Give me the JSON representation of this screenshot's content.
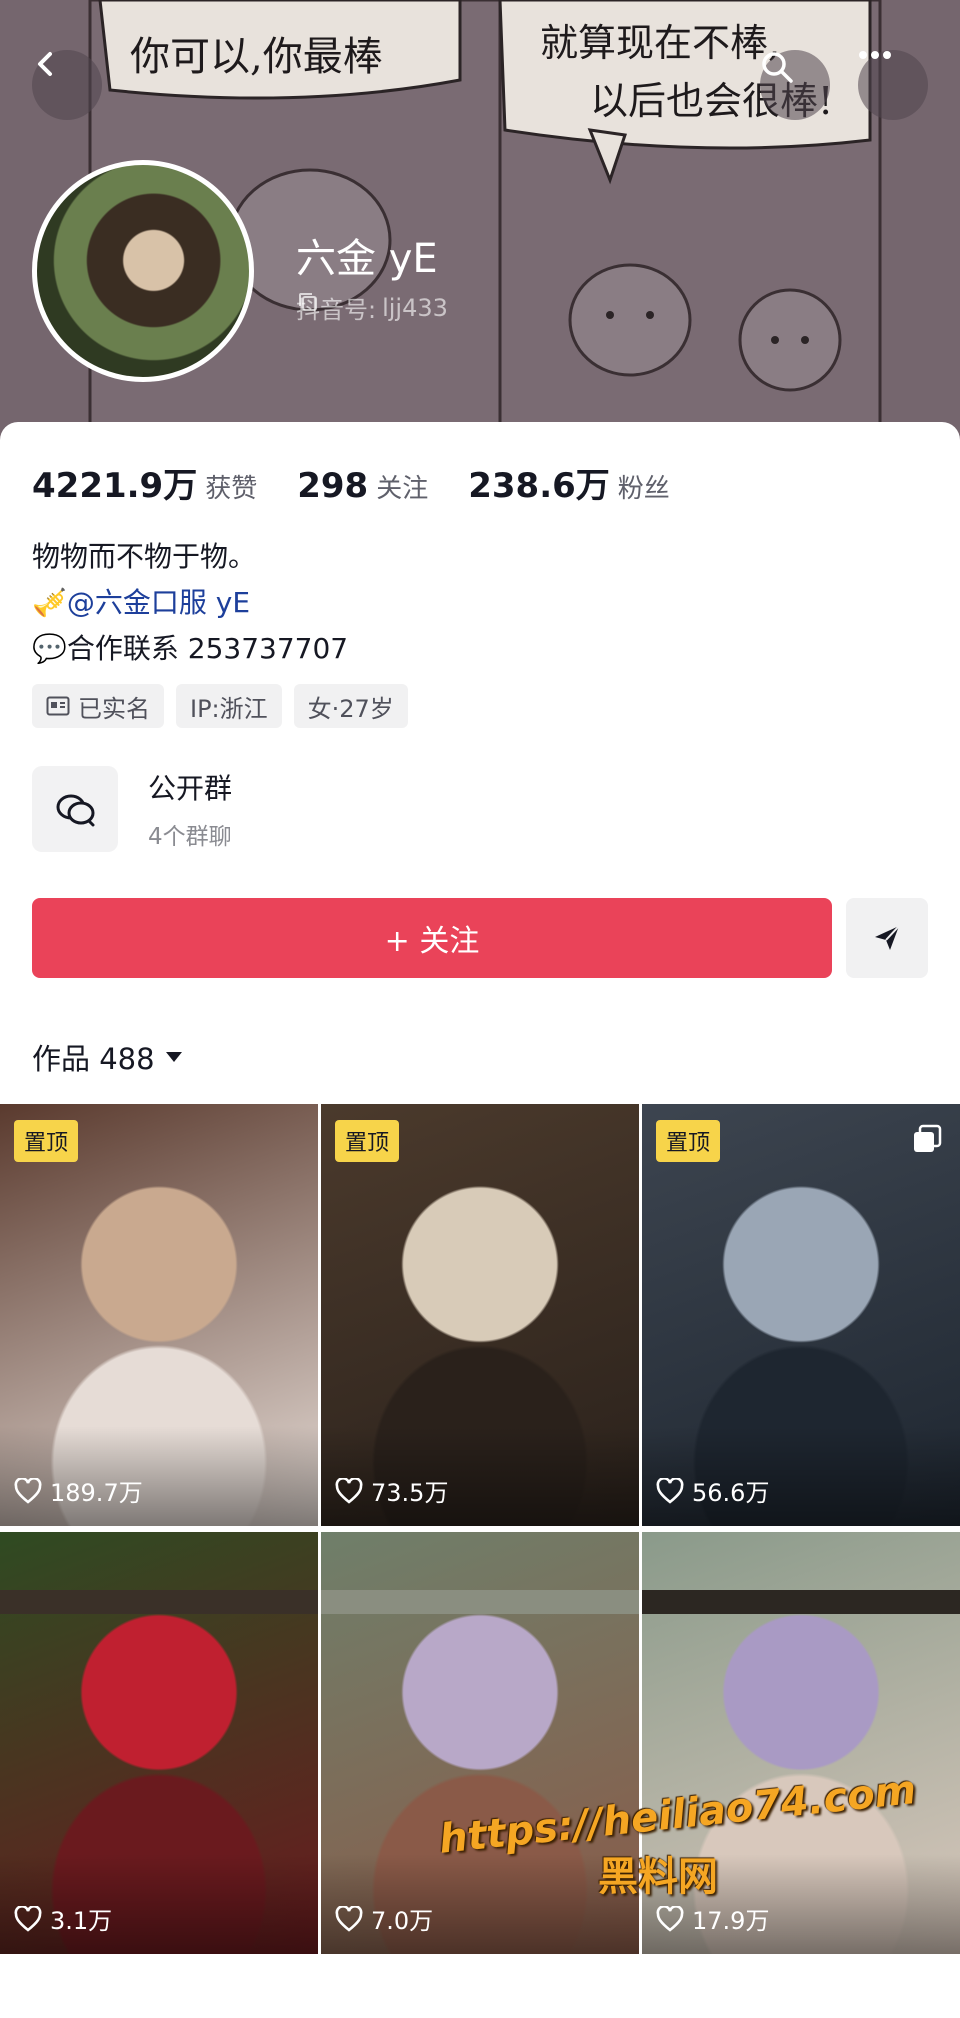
{
  "banner": {
    "comic_text_left": "你可以,你最棒",
    "comic_text_right_line1": "就算现在不棒,",
    "comic_text_right_line2": "以后也会很棒!"
  },
  "topbar": {
    "back_icon": "chevron-left-icon",
    "search_icon": "search-icon",
    "more_icon": "more-dots-icon"
  },
  "profile": {
    "name": "六金 yE",
    "id_label": "抖音号:",
    "id_value": "ljj433"
  },
  "stats": [
    {
      "value": "4221.9万",
      "label": "获赞"
    },
    {
      "value": "298",
      "label": "关注"
    },
    {
      "value": "238.6万",
      "label": "粉丝"
    }
  ],
  "bio": {
    "line1": "物物而不物于物。",
    "line2_prefix": "🎺",
    "line2_link": "@六金口服 yE",
    "line3_prefix": "💬",
    "line3_text": "合作联系 253737707"
  },
  "tags": [
    {
      "icon": "id-card-icon",
      "label": "已实名"
    },
    {
      "icon": "",
      "label": "IP:浙江"
    },
    {
      "icon": "",
      "label": "女·27岁"
    }
  ],
  "group": {
    "title": "公开群",
    "subtitle": "4个群聊"
  },
  "actions": {
    "follow_label": "+ 关注"
  },
  "works": {
    "label": "作品 488",
    "dropdown_icon": "caret-down-icon"
  },
  "videos": [
    {
      "likes": "189.7万",
      "pinned": true,
      "pin_label": "置顶",
      "multi": false,
      "colors": [
        "#5a3a2e",
        "#c9a98f",
        "#e6dcd6"
      ]
    },
    {
      "likes": "73.5万",
      "pinned": true,
      "pin_label": "置顶",
      "multi": false,
      "colors": [
        "#4b3a2c",
        "#d8cbb8",
        "#2a211b"
      ]
    },
    {
      "likes": "56.6万",
      "pinned": true,
      "pin_label": "置顶",
      "multi": true,
      "colors": [
        "#3d4550",
        "#9aa6b5",
        "#1e2630"
      ]
    },
    {
      "likes": "3.1万",
      "pinned": false,
      "pin_label": "",
      "multi": false,
      "colors": [
        "#2f4b22",
        "#c02030",
        "#6a1a1e"
      ]
    },
    {
      "likes": "7.0万",
      "pinned": false,
      "pin_label": "",
      "multi": false,
      "colors": [
        "#6f7f6a",
        "#b8a8c8",
        "#8a5a48"
      ]
    },
    {
      "likes": "17.9万",
      "pinned": false,
      "pin_label": "",
      "multi": false,
      "colors": [
        "#8a9a8a",
        "#a99ac4",
        "#d8c8bc"
      ]
    }
  ],
  "watermark": {
    "url": "https://heiliao74.com",
    "name": "黑料网"
  }
}
